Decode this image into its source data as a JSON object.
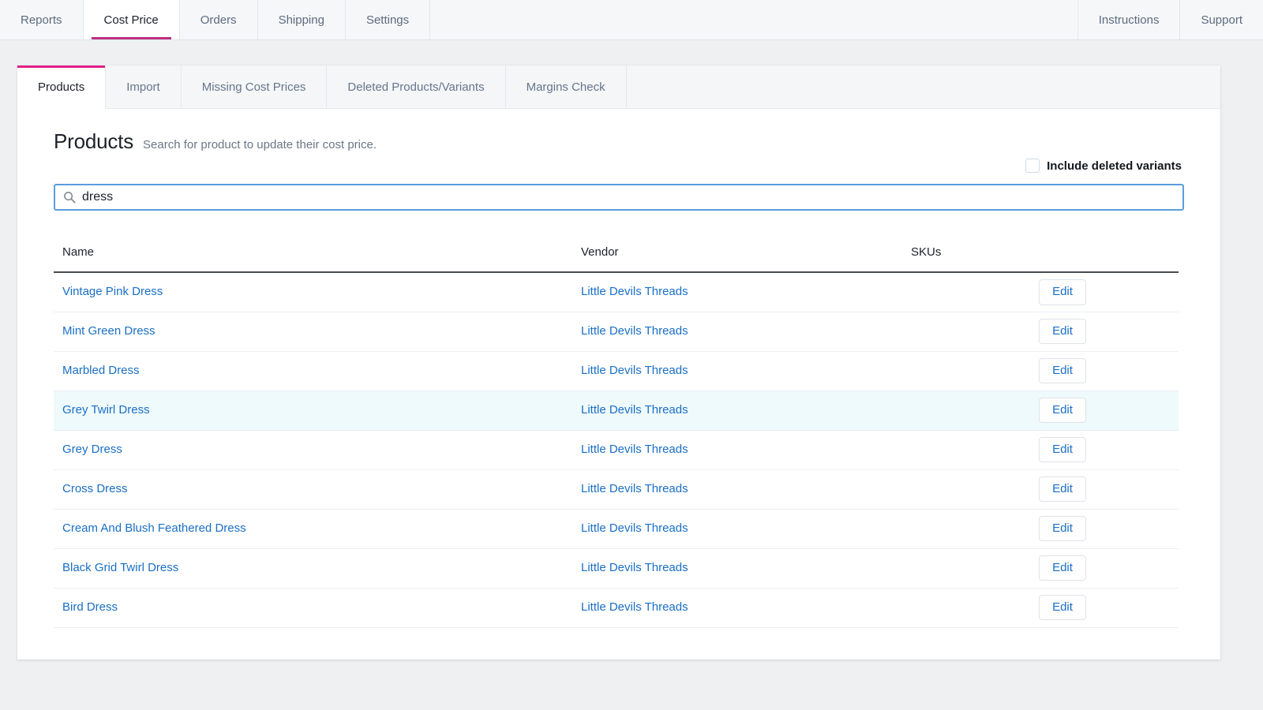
{
  "colors": {
    "accent_primary": "#bd3080",
    "accent_secondary": "#e0218a",
    "link_blue": "#1a6fc4",
    "focus_blue": "#5b9ede",
    "row_highlight": "#effafc",
    "page_background": "#eef0f1"
  },
  "topnav": {
    "left_tabs": [
      {
        "label": "Reports",
        "active": false
      },
      {
        "label": "Cost Price",
        "active": true
      },
      {
        "label": "Orders",
        "active": false
      },
      {
        "label": "Shipping",
        "active": false
      },
      {
        "label": "Settings",
        "active": false
      }
    ],
    "right_tabs": [
      {
        "label": "Instructions"
      },
      {
        "label": "Support"
      }
    ]
  },
  "subtabs": [
    {
      "label": "Products",
      "active": true
    },
    {
      "label": "Import",
      "active": false
    },
    {
      "label": "Missing Cost Prices",
      "active": false
    },
    {
      "label": "Deleted Products/Variants",
      "active": false
    },
    {
      "label": "Margins Check",
      "active": false
    }
  ],
  "header": {
    "title": "Products",
    "subtitle": "Search for product to update their cost price."
  },
  "include_deleted": {
    "label": "Include deleted variants",
    "checked": false
  },
  "search": {
    "value": "dress",
    "placeholder": "",
    "icon": "search-icon"
  },
  "table": {
    "columns": [
      "Name",
      "Vendor",
      "SKUs"
    ],
    "action_label": "Edit",
    "rows": [
      {
        "name": "Vintage Pink Dress",
        "vendor": "Little Devils Threads",
        "skus": "",
        "highlighted": false
      },
      {
        "name": "Mint Green Dress",
        "vendor": "Little Devils Threads",
        "skus": "",
        "highlighted": false
      },
      {
        "name": "Marbled Dress",
        "vendor": "Little Devils Threads",
        "skus": "",
        "highlighted": false
      },
      {
        "name": "Grey Twirl Dress",
        "vendor": "Little Devils Threads",
        "skus": "",
        "highlighted": true
      },
      {
        "name": "Grey Dress",
        "vendor": "Little Devils Threads",
        "skus": "",
        "highlighted": false
      },
      {
        "name": "Cross Dress",
        "vendor": "Little Devils Threads",
        "skus": "",
        "highlighted": false
      },
      {
        "name": "Cream And Blush Feathered Dress",
        "vendor": "Little Devils Threads",
        "skus": "",
        "highlighted": false
      },
      {
        "name": "Black Grid Twirl Dress",
        "vendor": "Little Devils Threads",
        "skus": "",
        "highlighted": false
      },
      {
        "name": "Bird Dress",
        "vendor": "Little Devils Threads",
        "skus": "",
        "highlighted": false
      }
    ]
  }
}
